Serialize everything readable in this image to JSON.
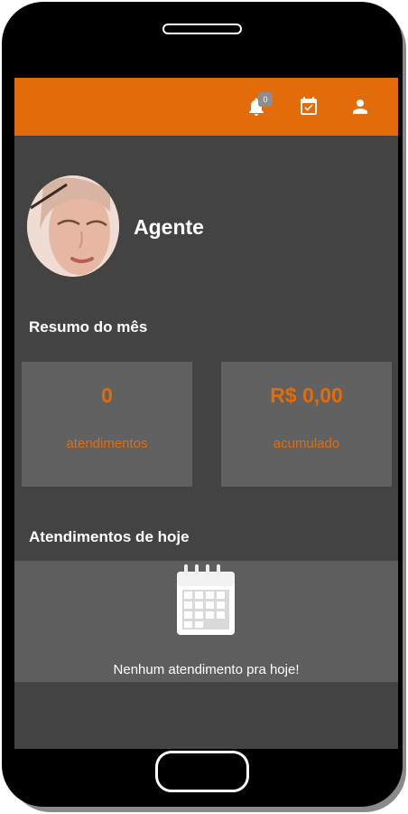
{
  "header": {
    "notification_count": "0",
    "icons": [
      "bell-icon",
      "calendar-check-icon",
      "user-icon"
    ],
    "accent_color": "#e36c0a"
  },
  "profile": {
    "name": "Agente"
  },
  "summary": {
    "title": "Resumo do mês",
    "cards": [
      {
        "value": "0",
        "label": "atendimentos"
      },
      {
        "value": "R$ 0,00",
        "label": "acumulado"
      }
    ]
  },
  "today": {
    "title": "Atendimentos de hoje",
    "empty_message": "Nenhum atendimento pra hoje!"
  }
}
